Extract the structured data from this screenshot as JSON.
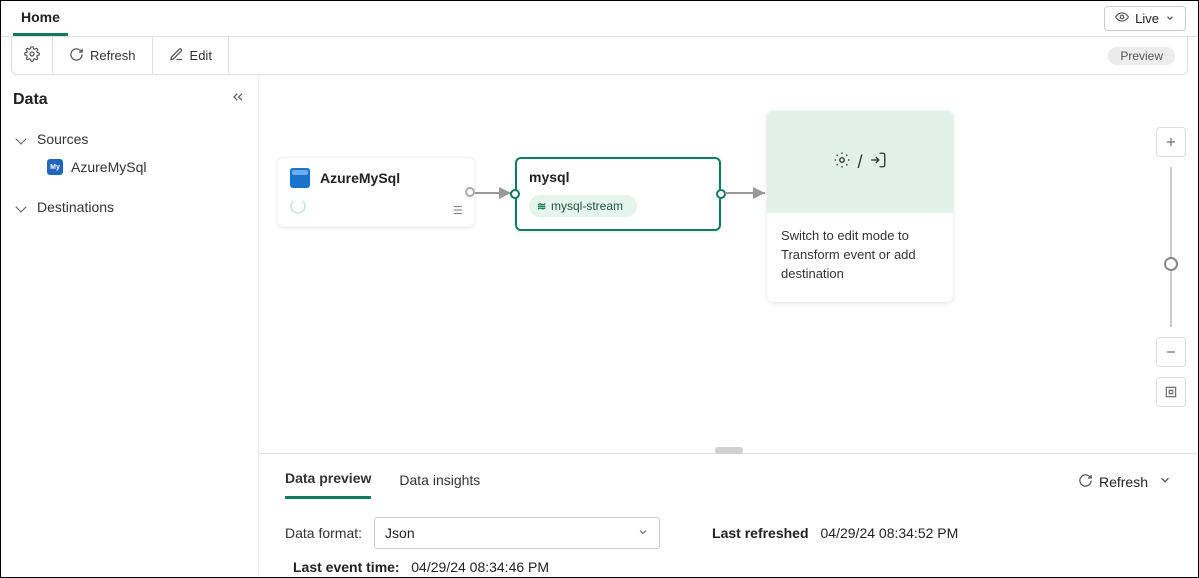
{
  "nav": {
    "home": "Home",
    "live_label": "Live"
  },
  "toolbar": {
    "refresh": "Refresh",
    "edit": "Edit",
    "preview_badge": "Preview"
  },
  "sidebar": {
    "title": "Data",
    "sections": [
      {
        "label": "Sources",
        "items": [
          {
            "label": "AzureMySql"
          }
        ]
      },
      {
        "label": "Destinations",
        "items": []
      }
    ]
  },
  "canvas": {
    "source_node": {
      "title": "AzureMySql"
    },
    "stream_node": {
      "title": "mysql",
      "stream_name": "mysql-stream"
    },
    "dest_node": {
      "helper_text": "Switch to edit mode to Transform event or add destination"
    }
  },
  "bottom": {
    "tabs": {
      "preview": "Data preview",
      "insights": "Data insights"
    },
    "refresh": "Refresh",
    "format_label": "Data format:",
    "format_value": "Json",
    "last_refreshed_label": "Last refreshed",
    "last_refreshed_value": "04/29/24 08:34:52 PM",
    "last_event_label": "Last event time:",
    "last_event_value": "04/29/24 08:34:46 PM"
  }
}
